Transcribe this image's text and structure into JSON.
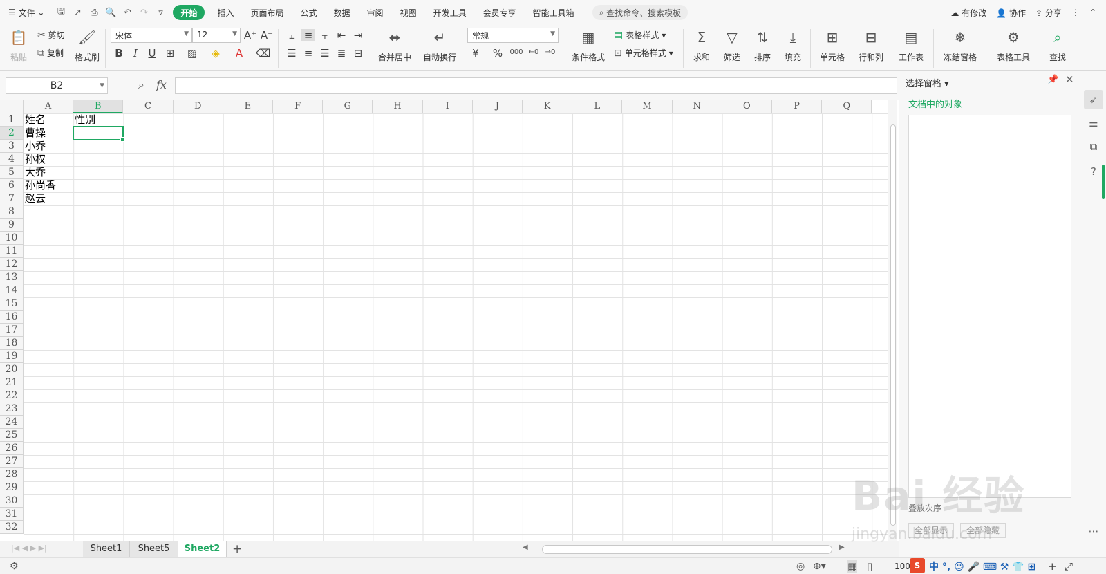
{
  "menubar": {
    "file": "文件",
    "tabs": [
      "开始",
      "插入",
      "页面布局",
      "公式",
      "数据",
      "审阅",
      "视图",
      "开发工具",
      "会员专享",
      "智能工具箱"
    ],
    "search_placeholder": "查找命令、搜索模板",
    "has_changes": "有修改",
    "collab": "协作",
    "share": "分享"
  },
  "ribbon": {
    "paste": "粘贴",
    "cut": "剪切",
    "copy": "复制",
    "format_painter": "格式刷",
    "font_name": "宋体",
    "font_size": "12",
    "bold": "B",
    "italic": "I",
    "underline": "U",
    "merge_center": "合并居中",
    "wrap_text": "自动换行",
    "number_format": "常规",
    "currency": "¥",
    "percent": "%",
    "thousands": "000",
    "conditional_format": "条件格式",
    "table_style": "表格样式",
    "cell_style": "单元格样式",
    "sum": "求和",
    "filter": "筛选",
    "sort": "排序",
    "fill": "填充",
    "cell": "单元格",
    "row_col": "行和列",
    "worksheet": "工作表",
    "freeze": "冻结窗格",
    "table_tools": "表格工具",
    "find": "查找"
  },
  "formula_bar": {
    "name_box": "B2",
    "fx": "fx",
    "content": ""
  },
  "grid": {
    "columns": [
      "A",
      "B",
      "C",
      "D",
      "E",
      "F",
      "G",
      "H",
      "I",
      "J",
      "K",
      "L",
      "M",
      "N",
      "O",
      "P",
      "Q"
    ],
    "rows": [
      "1",
      "2",
      "3",
      "4",
      "5",
      "6",
      "7",
      "8",
      "9",
      "10",
      "11",
      "12",
      "13",
      "14",
      "15",
      "16",
      "17",
      "18",
      "19",
      "20",
      "21",
      "22",
      "23",
      "24",
      "25",
      "26",
      "27",
      "28",
      "29",
      "30",
      "31",
      "32"
    ],
    "selected_cell": "B2",
    "cells": {
      "A1": "姓名",
      "B1": "性别",
      "A2": "曹操",
      "A3": "小乔",
      "A4": "孙权",
      "A5": "大乔",
      "A6": "孙尚香",
      "A7": "赵云"
    }
  },
  "sheets": {
    "tabs": [
      "Sheet1",
      "Sheet5",
      "Sheet2"
    ],
    "active": "Sheet2"
  },
  "pane": {
    "title": "选择窗格",
    "subtitle": "文档中的对象",
    "label": "叠放次序",
    "show_all": "全部显示",
    "hide_all": "全部隐藏"
  },
  "status": {
    "zoom": "100"
  },
  "watermark": {
    "logo": "Bai 经验",
    "url": "jingyan.baidu.com"
  },
  "colors": {
    "accent": "#1fa862",
    "toolbar_bg": "#f7f7f7",
    "grid_line": "#e3e3e3"
  }
}
